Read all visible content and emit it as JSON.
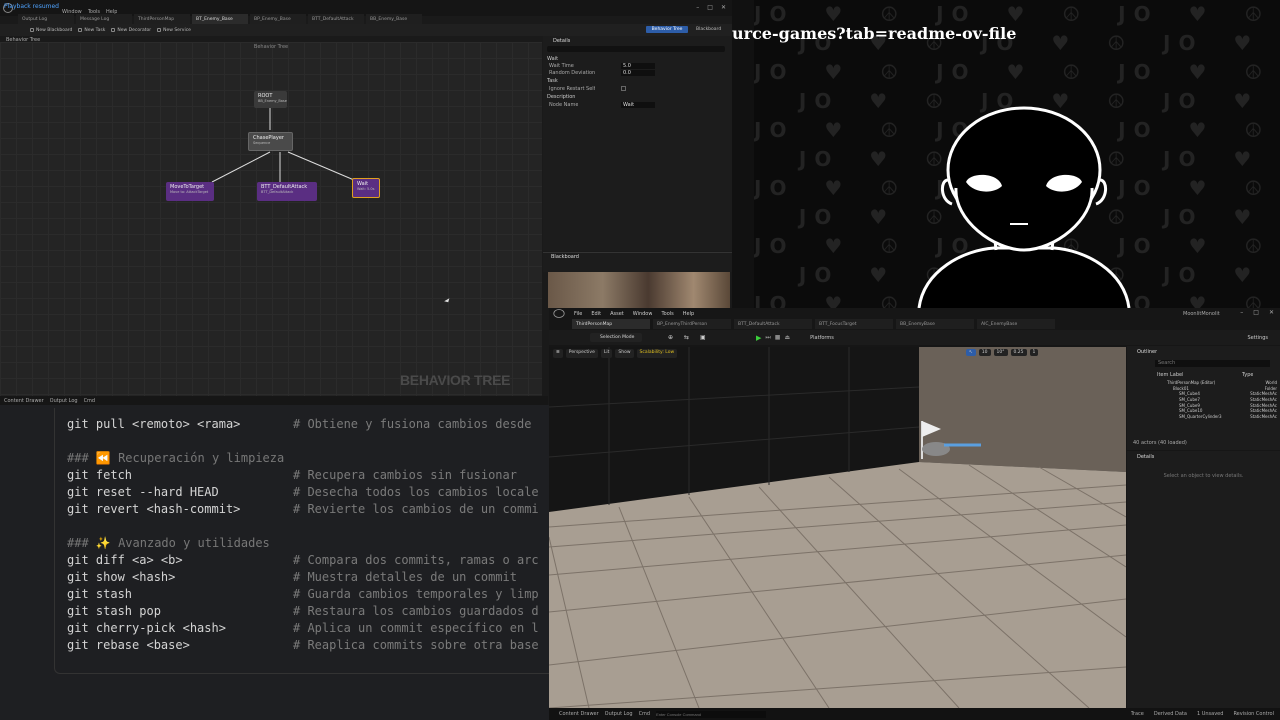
{
  "bt_window": {
    "notice": "Playback resumed",
    "title_menu": [
      "Window",
      "Tools",
      "Help"
    ],
    "tabs": [
      "Output Log",
      "Message Log",
      "ThirdPersonMap",
      "BT_Enemy_Base",
      "BP_Enemy_Base",
      "BTT_DefaultAttack",
      "BB_Enemy_Base"
    ],
    "toolbar": [
      "New Blackboard",
      "New Task",
      "New Decorator",
      "New Service"
    ],
    "toolbar_right": [
      "Behavior Tree",
      "Blackboard"
    ],
    "breadcrumb": "Behavior Tree",
    "canvas_title": "Behavior Tree",
    "watermark": "BEHAVIOR TREE",
    "nodes": {
      "root": {
        "title": "ROOT",
        "sub": "BB_Enemy_Base"
      },
      "chase": {
        "title": "ChasePlayer",
        "sub": "Sequence"
      },
      "move": {
        "title": "MoveToTarget",
        "sub": "Move to: AttackTarget"
      },
      "attack": {
        "title": "BTT_DefaultAttack",
        "sub": "BTT_DefaultAttack"
      },
      "wait": {
        "title": "Wait",
        "sub": "Wait: 5.0s"
      }
    },
    "details": {
      "title": "Details",
      "sections": [
        "Wait",
        "Task",
        "Description"
      ],
      "fields": [
        {
          "label": "Wait Time",
          "value": "5.0"
        },
        {
          "label": "Random Deviation",
          "value": "0.0"
        },
        {
          "label": "Ignore Restart Self",
          "value": ""
        },
        {
          "label": "Node Name",
          "value": "Wait"
        }
      ]
    },
    "blackboard_title": "Blackboard",
    "status": [
      "Content Drawer",
      "Output Log",
      "Cmd"
    ]
  },
  "terminal": {
    "lines": [
      {
        "cmd": "git pull <remoto> <rama>",
        "comment": "# Obtiene y fusiona cambios desde"
      },
      {
        "cmd": "",
        "comment": ""
      },
      {
        "header": "### ⏪ Recuperación y limpieza"
      },
      {
        "cmd": "git fetch",
        "comment": "# Recupera cambios sin fusionar"
      },
      {
        "cmd": "git reset --hard HEAD",
        "comment": "# Desecha todos los cambios locale"
      },
      {
        "cmd": "git revert <hash-commit>",
        "comment": "# Revierte los cambios de un commi"
      },
      {
        "cmd": "",
        "comment": ""
      },
      {
        "header": "### ✨ Avanzado y utilidades"
      },
      {
        "cmd": "git diff <a> <b>",
        "comment": "# Compara dos commits, ramas o arc"
      },
      {
        "cmd": "git show <hash>",
        "comment": "# Muestra detalles de un commit"
      },
      {
        "cmd": "git stash",
        "comment": "# Guarda cambios temporales y limp"
      },
      {
        "cmd": "git stash pop",
        "comment": "# Restaura los cambios guardados d"
      },
      {
        "cmd": "git cherry-pick <hash>",
        "comment": "# Aplica un commit específico en l"
      },
      {
        "cmd": "git rebase <base>",
        "comment": "# Reaplica commits sobre otra base"
      }
    ]
  },
  "overlay": {
    "url_fragment": "urce-games?tab=readme-ov-file",
    "pattern_text": "JO"
  },
  "ue": {
    "project": "MoonlitMonolit",
    "menu": [
      "File",
      "Edit",
      "Asset",
      "Window",
      "Tools",
      "Help"
    ],
    "tabs": [
      "ThirdPersonMap",
      "BP_EnemyThirdPerson",
      "BTT_DefaultAttack",
      "BTT_FocusTarget",
      "BB_EnemyBase",
      "AIC_EnemyBase"
    ],
    "toolbar": {
      "mode": "Selection Mode",
      "platforms": "Platforms",
      "settings": "Settings"
    },
    "viewport": {
      "perspective": "Perspective",
      "lit": "Lit",
      "show": "Show",
      "scalability": "Scalability: Low",
      "grid": "10",
      "angle": "10°",
      "scale": "0.25",
      "cam": "1"
    },
    "outliner": {
      "title": "Outliner",
      "search": "Search",
      "col_label": "Item Label",
      "col_type": "Type",
      "rows": [
        {
          "label": "ThirdPersonMap (Editor)",
          "type": "World"
        },
        {
          "label": "Block01",
          "type": "Folder"
        },
        {
          "label": "SM_Cube4",
          "type": "StaticMeshAc"
        },
        {
          "label": "SM_Cube7",
          "type": "StaticMeshAc"
        },
        {
          "label": "SM_Cube9",
          "type": "StaticMeshAc"
        },
        {
          "label": "SM_Cube10",
          "type": "StaticMeshAc"
        },
        {
          "label": "SM_QuarterCylinder3",
          "type": "StaticMeshAc"
        }
      ],
      "count": "40 actors (40 loaded)"
    },
    "details": {
      "title": "Details",
      "hint": "Select an object to view details."
    },
    "status": [
      "Content Drawer",
      "Output Log",
      "Cmd"
    ],
    "console_placeholder": "Enter Console Command",
    "status_right": [
      "Trace",
      "Derived Data",
      "1 Unsaved",
      "Revision Control"
    ]
  }
}
